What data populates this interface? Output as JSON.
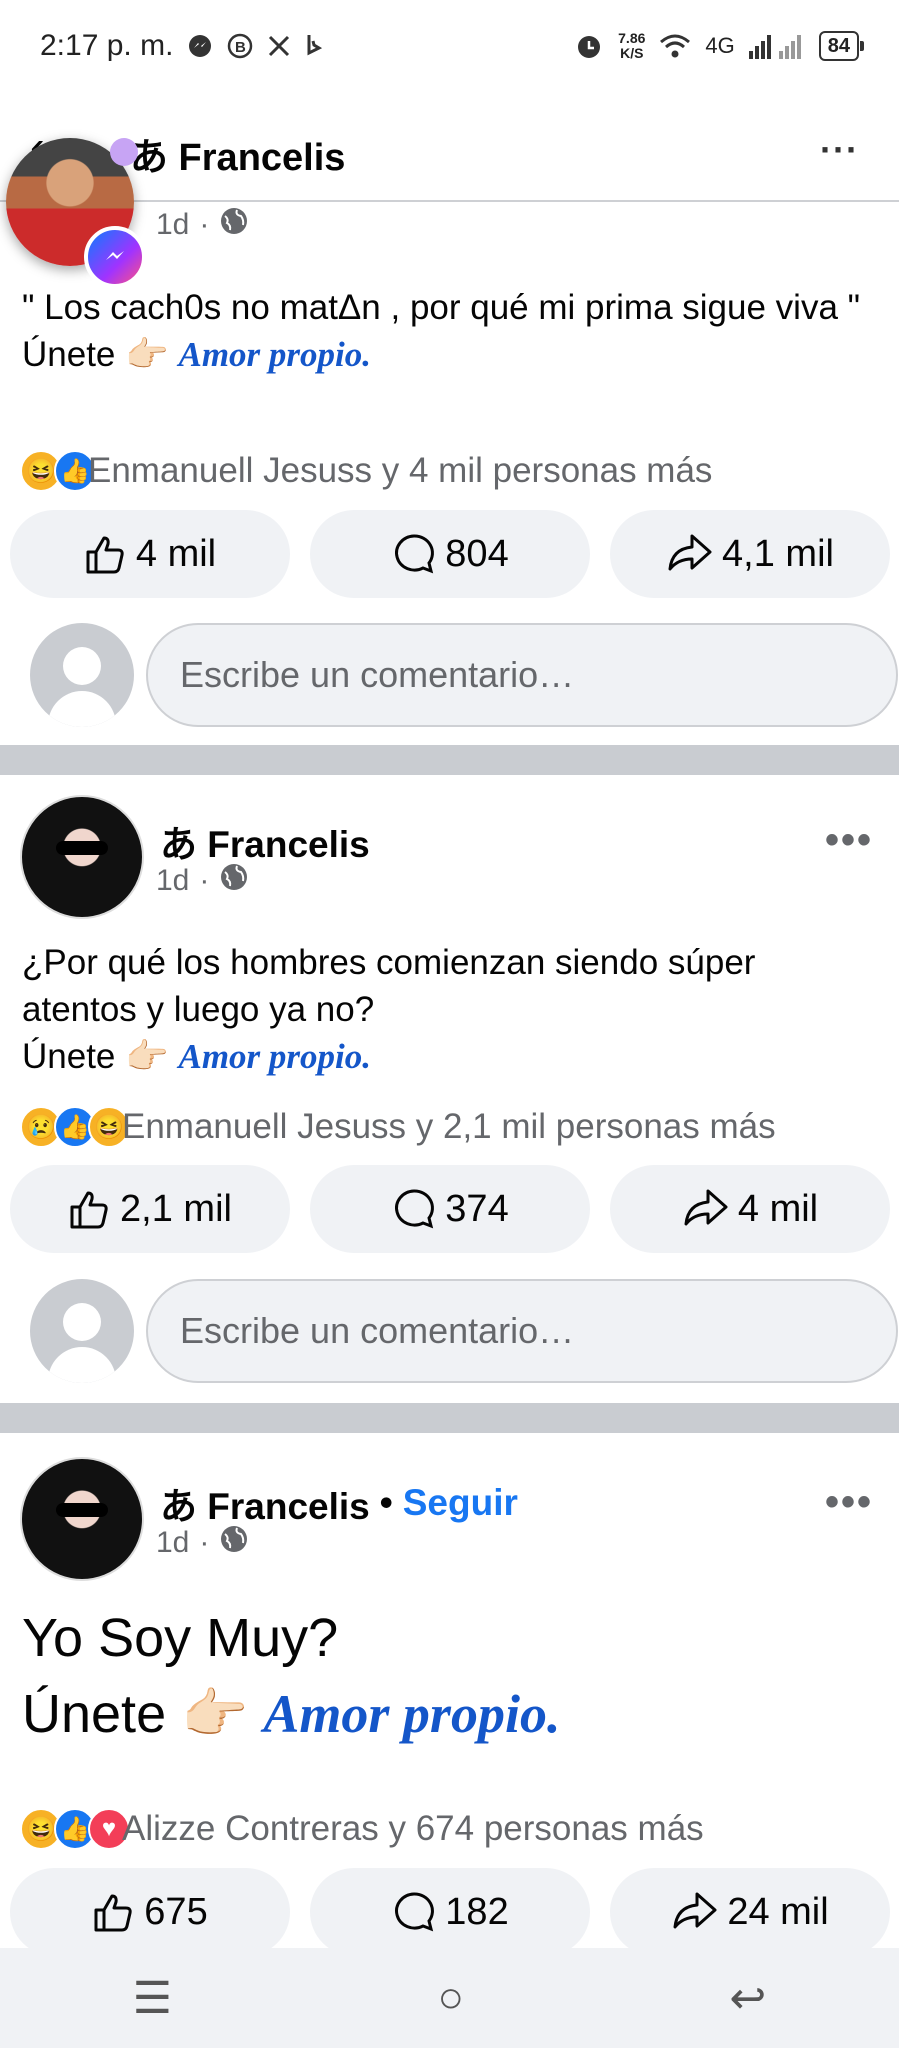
{
  "status": {
    "time": "2:17 p. m.",
    "speed_value": "7.86",
    "speed_unit": "K/S",
    "network": "4G",
    "battery": "84"
  },
  "header": {
    "title": "あ Francelis",
    "more": "···"
  },
  "posts": [
    {
      "time": "1d",
      "sep": "·",
      "text_line1": "\" Los cach0s no matΔn , por qué mi prima sigue viva \"",
      "join_text": "Únete",
      "emoji": "👉🏻",
      "amor": "Amor propio.",
      "reactions_text": "Enmanuell Jesuss y 4 mil personas más",
      "likes": "4 mil",
      "comments": "804",
      "shares": "4,1 mil",
      "comment_placeholder": "Escribe un comentario…"
    },
    {
      "author": "あ Francelis",
      "time": "1d",
      "sep": "·",
      "text_line1": "¿Por qué los hombres comienzan siendo súper atentos y luego ya no?",
      "join_text": "Únete",
      "emoji": "👉🏻",
      "amor": "Amor propio.",
      "reactions_text": "Enmanuell Jesuss y 2,1 mil personas más",
      "likes": "2,1 mil",
      "comments": "374",
      "shares": "4 mil",
      "comment_placeholder": "Escribe un comentario…"
    },
    {
      "author": "あ Francelis",
      "bullet": "•",
      "follow": "Seguir",
      "time": "1d",
      "sep": "·",
      "text_line1": "Yo Soy Muy?",
      "join_text": "Únete",
      "emoji": "👉🏻",
      "amor": "Amor propio.",
      "reactions_text": "Alizze Contreras y 674 personas más",
      "likes": "675",
      "comments": "182",
      "shares": "24 mil"
    }
  ],
  "navbar": {
    "menu": "☰",
    "home": "○",
    "back": "↩"
  }
}
